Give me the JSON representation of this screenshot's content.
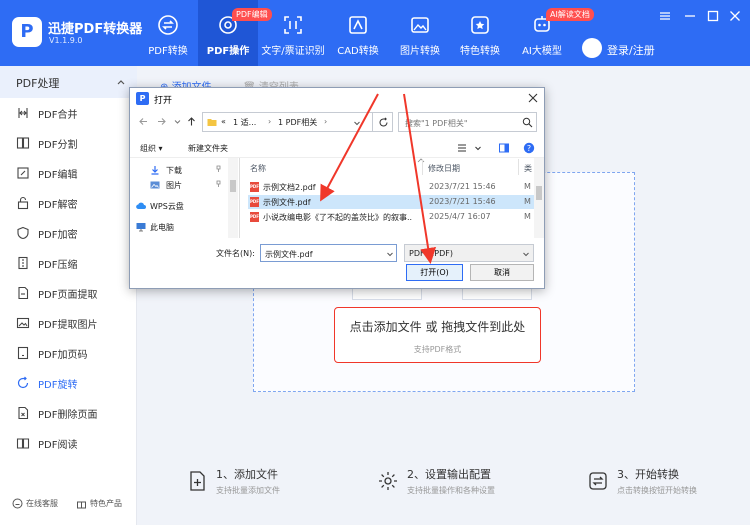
{
  "app": {
    "name": "迅捷PDF转换器",
    "version": "V1.1.9.0",
    "logo_letter": "P",
    "accent_color": "#2e6cf4"
  },
  "nav": {
    "items": [
      {
        "label": "PDF转换",
        "icon": "swap-circle-icon"
      },
      {
        "label": "PDF操作",
        "icon": "gear-icon",
        "badge": "PDF编辑"
      },
      {
        "label": "文字/票证识别",
        "icon": "scan-icon"
      },
      {
        "label": "CAD转换",
        "icon": "cad-icon"
      },
      {
        "label": "图片转换",
        "icon": "image-icon"
      },
      {
        "label": "特色转换",
        "icon": "star-box-icon"
      },
      {
        "label": "AI大模型",
        "icon": "ai-icon",
        "badge": "AI解读文档"
      }
    ],
    "login": "登录/注册"
  },
  "sidebar": {
    "title": "PDF处理",
    "items": [
      {
        "label": "PDF合并"
      },
      {
        "label": "PDF分割"
      },
      {
        "label": "PDF编辑"
      },
      {
        "label": "PDF解密"
      },
      {
        "label": "PDF加密"
      },
      {
        "label": "PDF压缩"
      },
      {
        "label": "PDF页面提取"
      },
      {
        "label": "PDF提取图片"
      },
      {
        "label": "PDF加页码"
      },
      {
        "label": "PDF旋转"
      },
      {
        "label": "PDF删除页面"
      },
      {
        "label": "PDF阅读"
      }
    ],
    "bottom": {
      "service": "在线客服",
      "products": "特色产品"
    }
  },
  "main": {
    "add_file": "添加文件",
    "clear_list": "清空列表",
    "drop_title": "点击添加文件 或 拖拽文件到此处",
    "drop_sub": "支持PDF格式",
    "steps": [
      {
        "title": "1、添加文件",
        "sub": "支持批量添加文件"
      },
      {
        "title": "2、设置输出配置",
        "sub": "支持批量操作和各种设置"
      },
      {
        "title": "3、开始转换",
        "sub": "点击转换按钮开始转换"
      }
    ]
  },
  "dialog": {
    "title": "打开",
    "path": {
      "root": "«",
      "part1": "1 适...",
      "part2": "1 PDF相关"
    },
    "search_placeholder": "搜索\"1 PDF相关\"",
    "organize": "组织",
    "new_folder": "新建文件夹",
    "nav_pane": [
      "下载",
      "图片",
      "WPS云盘",
      "此电脑"
    ],
    "columns": {
      "name": "名称",
      "date": "修改日期",
      "type": "类"
    },
    "files": [
      {
        "name": "示例文档2.pdf",
        "date": "2023/7/21 15:46",
        "type": "M"
      },
      {
        "name": "示例文件.pdf",
        "date": "2023/7/21 15:46",
        "type": "M"
      },
      {
        "name": "小说改编电影《了不起的盖茨比》的叙事...",
        "date": "2025/4/7 16:07",
        "type": "M"
      }
    ],
    "filename_label": "文件名(N):",
    "filename_value": "示例文件.pdf",
    "filetype_value": "PDF(*.PDF)",
    "open_label": "打开(O)",
    "cancel_label": "取消",
    "file_icon_text": "PDF"
  }
}
